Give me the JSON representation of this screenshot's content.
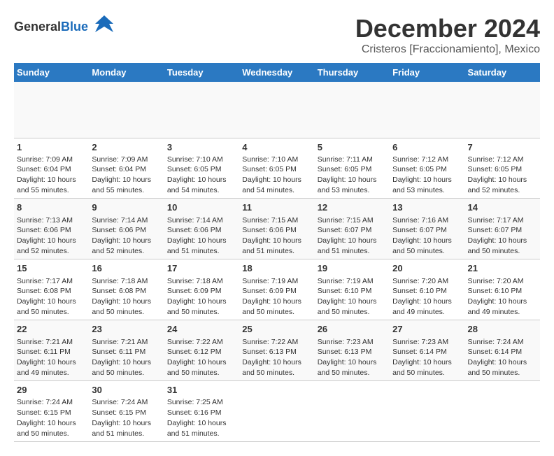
{
  "header": {
    "logo_general": "General",
    "logo_blue": "Blue",
    "title": "December 2024",
    "subtitle": "Cristeros [Fraccionamiento], Mexico"
  },
  "calendar": {
    "days_of_week": [
      "Sunday",
      "Monday",
      "Tuesday",
      "Wednesday",
      "Thursday",
      "Friday",
      "Saturday"
    ],
    "weeks": [
      [
        {
          "day": "",
          "lines": []
        },
        {
          "day": "",
          "lines": []
        },
        {
          "day": "",
          "lines": []
        },
        {
          "day": "",
          "lines": []
        },
        {
          "day": "",
          "lines": []
        },
        {
          "day": "",
          "lines": []
        },
        {
          "day": "",
          "lines": []
        }
      ],
      [
        {
          "day": "1",
          "lines": [
            "Sunrise: 7:09 AM",
            "Sunset: 6:04 PM",
            "Daylight: 10 hours",
            "and 55 minutes."
          ]
        },
        {
          "day": "2",
          "lines": [
            "Sunrise: 7:09 AM",
            "Sunset: 6:04 PM",
            "Daylight: 10 hours",
            "and 55 minutes."
          ]
        },
        {
          "day": "3",
          "lines": [
            "Sunrise: 7:10 AM",
            "Sunset: 6:05 PM",
            "Daylight: 10 hours",
            "and 54 minutes."
          ]
        },
        {
          "day": "4",
          "lines": [
            "Sunrise: 7:10 AM",
            "Sunset: 6:05 PM",
            "Daylight: 10 hours",
            "and 54 minutes."
          ]
        },
        {
          "day": "5",
          "lines": [
            "Sunrise: 7:11 AM",
            "Sunset: 6:05 PM",
            "Daylight: 10 hours",
            "and 53 minutes."
          ]
        },
        {
          "day": "6",
          "lines": [
            "Sunrise: 7:12 AM",
            "Sunset: 6:05 PM",
            "Daylight: 10 hours",
            "and 53 minutes."
          ]
        },
        {
          "day": "7",
          "lines": [
            "Sunrise: 7:12 AM",
            "Sunset: 6:05 PM",
            "Daylight: 10 hours",
            "and 52 minutes."
          ]
        }
      ],
      [
        {
          "day": "8",
          "lines": [
            "Sunrise: 7:13 AM",
            "Sunset: 6:06 PM",
            "Daylight: 10 hours",
            "and 52 minutes."
          ]
        },
        {
          "day": "9",
          "lines": [
            "Sunrise: 7:14 AM",
            "Sunset: 6:06 PM",
            "Daylight: 10 hours",
            "and 52 minutes."
          ]
        },
        {
          "day": "10",
          "lines": [
            "Sunrise: 7:14 AM",
            "Sunset: 6:06 PM",
            "Daylight: 10 hours",
            "and 51 minutes."
          ]
        },
        {
          "day": "11",
          "lines": [
            "Sunrise: 7:15 AM",
            "Sunset: 6:06 PM",
            "Daylight: 10 hours",
            "and 51 minutes."
          ]
        },
        {
          "day": "12",
          "lines": [
            "Sunrise: 7:15 AM",
            "Sunset: 6:07 PM",
            "Daylight: 10 hours",
            "and 51 minutes."
          ]
        },
        {
          "day": "13",
          "lines": [
            "Sunrise: 7:16 AM",
            "Sunset: 6:07 PM",
            "Daylight: 10 hours",
            "and 50 minutes."
          ]
        },
        {
          "day": "14",
          "lines": [
            "Sunrise: 7:17 AM",
            "Sunset: 6:07 PM",
            "Daylight: 10 hours",
            "and 50 minutes."
          ]
        }
      ],
      [
        {
          "day": "15",
          "lines": [
            "Sunrise: 7:17 AM",
            "Sunset: 6:08 PM",
            "Daylight: 10 hours",
            "and 50 minutes."
          ]
        },
        {
          "day": "16",
          "lines": [
            "Sunrise: 7:18 AM",
            "Sunset: 6:08 PM",
            "Daylight: 10 hours",
            "and 50 minutes."
          ]
        },
        {
          "day": "17",
          "lines": [
            "Sunrise: 7:18 AM",
            "Sunset: 6:09 PM",
            "Daylight: 10 hours",
            "and 50 minutes."
          ]
        },
        {
          "day": "18",
          "lines": [
            "Sunrise: 7:19 AM",
            "Sunset: 6:09 PM",
            "Daylight: 10 hours",
            "and 50 minutes."
          ]
        },
        {
          "day": "19",
          "lines": [
            "Sunrise: 7:19 AM",
            "Sunset: 6:10 PM",
            "Daylight: 10 hours",
            "and 50 minutes."
          ]
        },
        {
          "day": "20",
          "lines": [
            "Sunrise: 7:20 AM",
            "Sunset: 6:10 PM",
            "Daylight: 10 hours",
            "and 49 minutes."
          ]
        },
        {
          "day": "21",
          "lines": [
            "Sunrise: 7:20 AM",
            "Sunset: 6:10 PM",
            "Daylight: 10 hours",
            "and 49 minutes."
          ]
        }
      ],
      [
        {
          "day": "22",
          "lines": [
            "Sunrise: 7:21 AM",
            "Sunset: 6:11 PM",
            "Daylight: 10 hours",
            "and 49 minutes."
          ]
        },
        {
          "day": "23",
          "lines": [
            "Sunrise: 7:21 AM",
            "Sunset: 6:11 PM",
            "Daylight: 10 hours",
            "and 50 minutes."
          ]
        },
        {
          "day": "24",
          "lines": [
            "Sunrise: 7:22 AM",
            "Sunset: 6:12 PM",
            "Daylight: 10 hours",
            "and 50 minutes."
          ]
        },
        {
          "day": "25",
          "lines": [
            "Sunrise: 7:22 AM",
            "Sunset: 6:13 PM",
            "Daylight: 10 hours",
            "and 50 minutes."
          ]
        },
        {
          "day": "26",
          "lines": [
            "Sunrise: 7:23 AM",
            "Sunset: 6:13 PM",
            "Daylight: 10 hours",
            "and 50 minutes."
          ]
        },
        {
          "day": "27",
          "lines": [
            "Sunrise: 7:23 AM",
            "Sunset: 6:14 PM",
            "Daylight: 10 hours",
            "and 50 minutes."
          ]
        },
        {
          "day": "28",
          "lines": [
            "Sunrise: 7:24 AM",
            "Sunset: 6:14 PM",
            "Daylight: 10 hours",
            "and 50 minutes."
          ]
        }
      ],
      [
        {
          "day": "29",
          "lines": [
            "Sunrise: 7:24 AM",
            "Sunset: 6:15 PM",
            "Daylight: 10 hours",
            "and 50 minutes."
          ]
        },
        {
          "day": "30",
          "lines": [
            "Sunrise: 7:24 AM",
            "Sunset: 6:15 PM",
            "Daylight: 10 hours",
            "and 51 minutes."
          ]
        },
        {
          "day": "31",
          "lines": [
            "Sunrise: 7:25 AM",
            "Sunset: 6:16 PM",
            "Daylight: 10 hours",
            "and 51 minutes."
          ]
        },
        {
          "day": "",
          "lines": []
        },
        {
          "day": "",
          "lines": []
        },
        {
          "day": "",
          "lines": []
        },
        {
          "day": "",
          "lines": []
        }
      ]
    ]
  }
}
